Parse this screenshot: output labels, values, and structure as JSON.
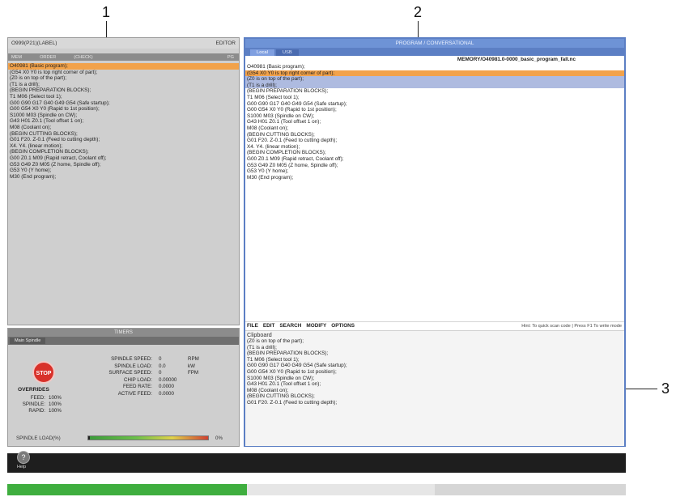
{
  "callouts": [
    "1",
    "2",
    "3"
  ],
  "left_panel": {
    "title": "O999(P21)(LABEL)",
    "mode": "EDITOR",
    "tabs": [
      "MEM",
      "ORDER",
      "(CHECK)",
      "PG"
    ],
    "lines": [
      {
        "text": "O40981 (Basic program);",
        "hl": "orange"
      },
      {
        "text": "(G54 X0 Y0 is top right corner of part);",
        "hl": ""
      },
      {
        "text": "(Z0 is on top of the part);",
        "hl": ""
      },
      {
        "text": "(T1 is a drill);",
        "hl": ""
      },
      {
        "text": "(BEGIN PREPARATION BLOCKS);",
        "hl": ""
      },
      {
        "text": "T1 M06 (Select tool 1);",
        "hl": ""
      },
      {
        "text": "G00 G90 G17 G40 G49 G54 (Safe startup);",
        "hl": ""
      },
      {
        "text": "G00 G54 X0 Y0 (Rapid to 1st position);",
        "hl": ""
      },
      {
        "text": "S1000 M03 (Spindle on CW);",
        "hl": ""
      },
      {
        "text": "G43 H01 Z0.1 (Tool offset 1 on);",
        "hl": ""
      },
      {
        "text": "M08 (Coolant on);",
        "hl": ""
      },
      {
        "text": "(BEGIN CUTTING BLOCKS);",
        "hl": ""
      },
      {
        "text": "G01 F20. Z-0.1 (Feed to cutting depth);",
        "hl": ""
      },
      {
        "text": "X4. Y4. (linear motion);",
        "hl": ""
      },
      {
        "text": "(BEGIN COMPLETION BLOCKS);",
        "hl": ""
      },
      {
        "text": "G00 Z0.1 M09 (Rapid retract, Coolant off);",
        "hl": ""
      },
      {
        "text": "G53 G49 Z0 M05 (Z home, Spindle off);",
        "hl": ""
      },
      {
        "text": "G53 Y0 (Y home);",
        "hl": ""
      },
      {
        "text": "M30 (End program);",
        "hl": ""
      }
    ]
  },
  "right_panel": {
    "title": "PROGRAM / CONVERSATIONAL",
    "tabs": [
      "Local",
      "USB"
    ],
    "path": "MEMORY/O40981.0-0000_basic_program_fall.nc",
    "lines": [
      {
        "text": "O40981 (Basic program);",
        "hl": ""
      },
      {
        "text": "(G54 X0 Y0 is top right corner of part);",
        "hl": "orange"
      },
      {
        "text": "(Z0 is on top of the part);",
        "hl": "blue"
      },
      {
        "text": "(T1 is a drill);",
        "hl": "blue"
      },
      {
        "text": "(BEGIN PREPARATION BLOCKS);",
        "hl": ""
      },
      {
        "text": "T1 M06 (Select tool 1);",
        "hl": ""
      },
      {
        "text": "G00 G90 G17 G40 G49 G54 (Safe startup);",
        "hl": ""
      },
      {
        "text": "G00 G54 X0 Y0 (Rapid to 1st position);",
        "hl": ""
      },
      {
        "text": "S1000 M03 (Spindle on CW);",
        "hl": ""
      },
      {
        "text": "G43 H01 Z0.1 (Tool offset 1 on);",
        "hl": ""
      },
      {
        "text": "M08 (Coolant on);",
        "hl": ""
      },
      {
        "text": "(BEGIN CUTTING BLOCKS);",
        "hl": ""
      },
      {
        "text": "G01 F20. Z-0.1 (Feed to cutting depth);",
        "hl": ""
      },
      {
        "text": "X4. Y4. (linear motion);",
        "hl": ""
      },
      {
        "text": "(BEGIN COMPLETION BLOCKS);",
        "hl": ""
      },
      {
        "text": "G00 Z0.1 M09 (Rapid retract, Coolant off);",
        "hl": ""
      },
      {
        "text": "G53 G49 Z0 M05 (Z home, Spindle off);",
        "hl": ""
      },
      {
        "text": "G53 Y0 (Y home);",
        "hl": ""
      },
      {
        "text": "M30 (End program);",
        "hl": ""
      }
    ],
    "menu": [
      "FILE",
      "EDIT",
      "SEARCH",
      "MODIFY",
      "OPTIONS"
    ],
    "menu_hint": "Hint: To quick scan code | Press F1 To write mode",
    "clipboard_title": "Clipboard",
    "clipboard_lines": [
      "(Z0 is on top of the part);",
      "(T1 is a drill);",
      "(BEGIN PREPARATION BLOCKS);",
      "T1 M06 (Select tool 1);",
      "G00 G90 G17 G40 G49 G54 (Safe startup);",
      "G00 G54 X0 Y0 (Rapid to 1st position);",
      "S1000 M03 (Spindle on CW);",
      "G43 H01 Z0.1 (Tool offset 1 on);",
      "M08 (Coolant on);",
      "(BEGIN CUTTING BLOCKS);",
      "G01 F20. Z-0.1 (Feed to cutting depth);"
    ]
  },
  "timer": {
    "title": "TIMERS",
    "tab": "Main Spindle",
    "stop_label": "STOP",
    "overrides_label": "OVERRIDES",
    "overrides": [
      {
        "label": "FEED:",
        "value": "100%"
      },
      {
        "label": "SPINDLE:",
        "value": "100%"
      },
      {
        "label": "RAPID:",
        "value": "100%"
      }
    ],
    "stats": [
      {
        "label": "SPINDLE SPEED:",
        "value": "0",
        "unit": "RPM"
      },
      {
        "label": "SPINDLE LOAD:",
        "value": "0.0",
        "unit": "kW"
      },
      {
        "label": "SURFACE SPEED:",
        "value": "0",
        "unit": "FPM"
      },
      {
        "label": "CHIP LOAD:",
        "value": "0.00000",
        "unit": ""
      },
      {
        "label": "FEED RATE:",
        "value": "0.0000",
        "unit": ""
      },
      {
        "label": "ACTIVE FEED:",
        "value": "0.0000",
        "unit": ""
      }
    ],
    "load_label": "SPINDLE LOAD(%)",
    "load_value": "0%",
    "load_fraction": 0.0
  },
  "bottom": {
    "help_label": "Help"
  }
}
